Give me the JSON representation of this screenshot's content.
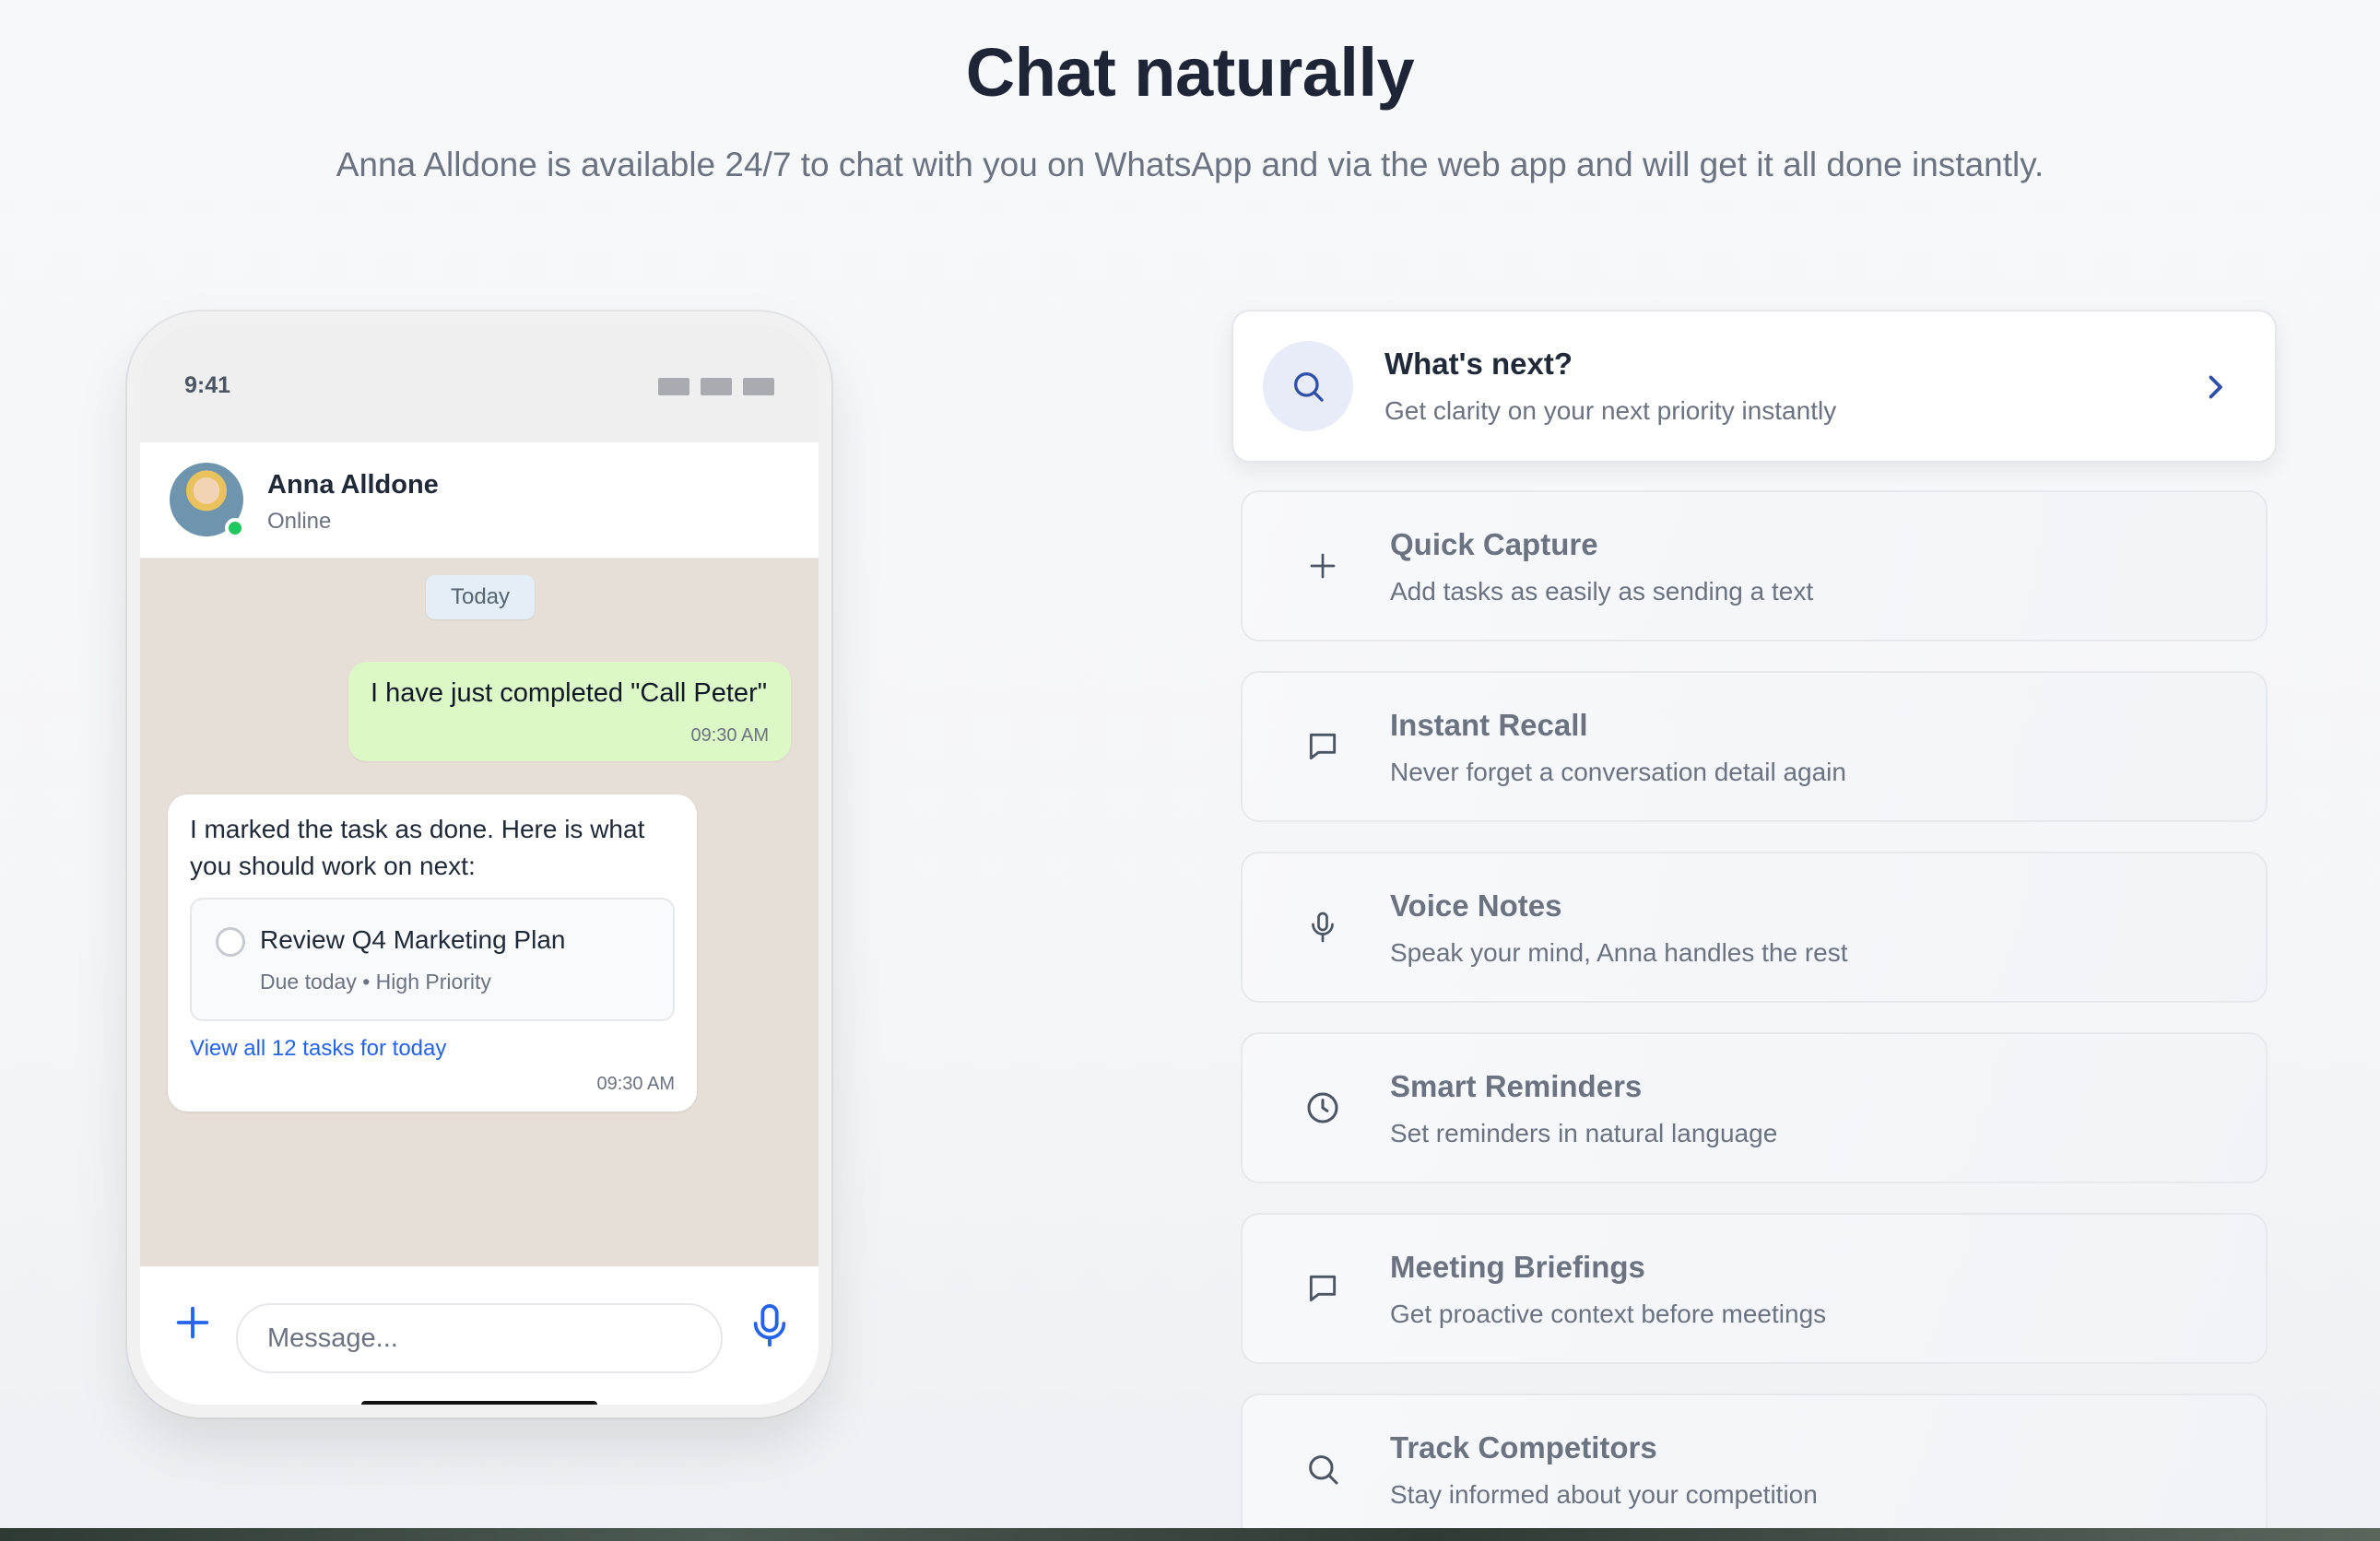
{
  "header": {
    "title": "Chat naturally",
    "subtitle": "Anna Alldone is available 24/7 to chat with you on WhatsApp and via the web app and will get it all done instantly."
  },
  "phone": {
    "status_time": "9:41",
    "contact": {
      "name": "Anna Alldone",
      "status": "Online"
    },
    "day_badge": "Today",
    "messages": [
      {
        "direction": "outgoing",
        "text": "I have just completed \"Call Peter\"",
        "time": "09:30 AM"
      },
      {
        "direction": "incoming",
        "text": "I marked the task as done. Here is what you should work on next:",
        "task": {
          "title": "Review Q4 Marketing Plan",
          "meta": "Due today • High Priority"
        },
        "link": "View all 12 tasks for today",
        "time": "09:30 AM"
      }
    ],
    "composer": {
      "placeholder": "Message..."
    }
  },
  "features": [
    {
      "title": "What's next?",
      "desc": "Get clarity on your next priority instantly",
      "icon": "search-icon",
      "active": true
    },
    {
      "title": "Quick Capture",
      "desc": "Add tasks as easily as sending a text",
      "icon": "plus-icon"
    },
    {
      "title": "Instant Recall",
      "desc": "Never forget a conversation detail again",
      "icon": "chat-bubble-icon"
    },
    {
      "title": "Voice Notes",
      "desc": "Speak your mind, Anna handles the rest",
      "icon": "microphone-icon"
    },
    {
      "title": "Smart Reminders",
      "desc": "Set reminders in natural language",
      "icon": "clock-icon"
    },
    {
      "title": "Meeting Briefings",
      "desc": "Get proactive context before meetings",
      "icon": "chat-bubble-icon"
    },
    {
      "title": "Track Competitors",
      "desc": "Stay informed about your competition",
      "icon": "search-icon"
    }
  ],
  "colors": {
    "accent": "#2563eb",
    "outgoing_bubble": "#dcf8c6",
    "chat_background": "#e6dfd7",
    "online": "#22c55e"
  }
}
